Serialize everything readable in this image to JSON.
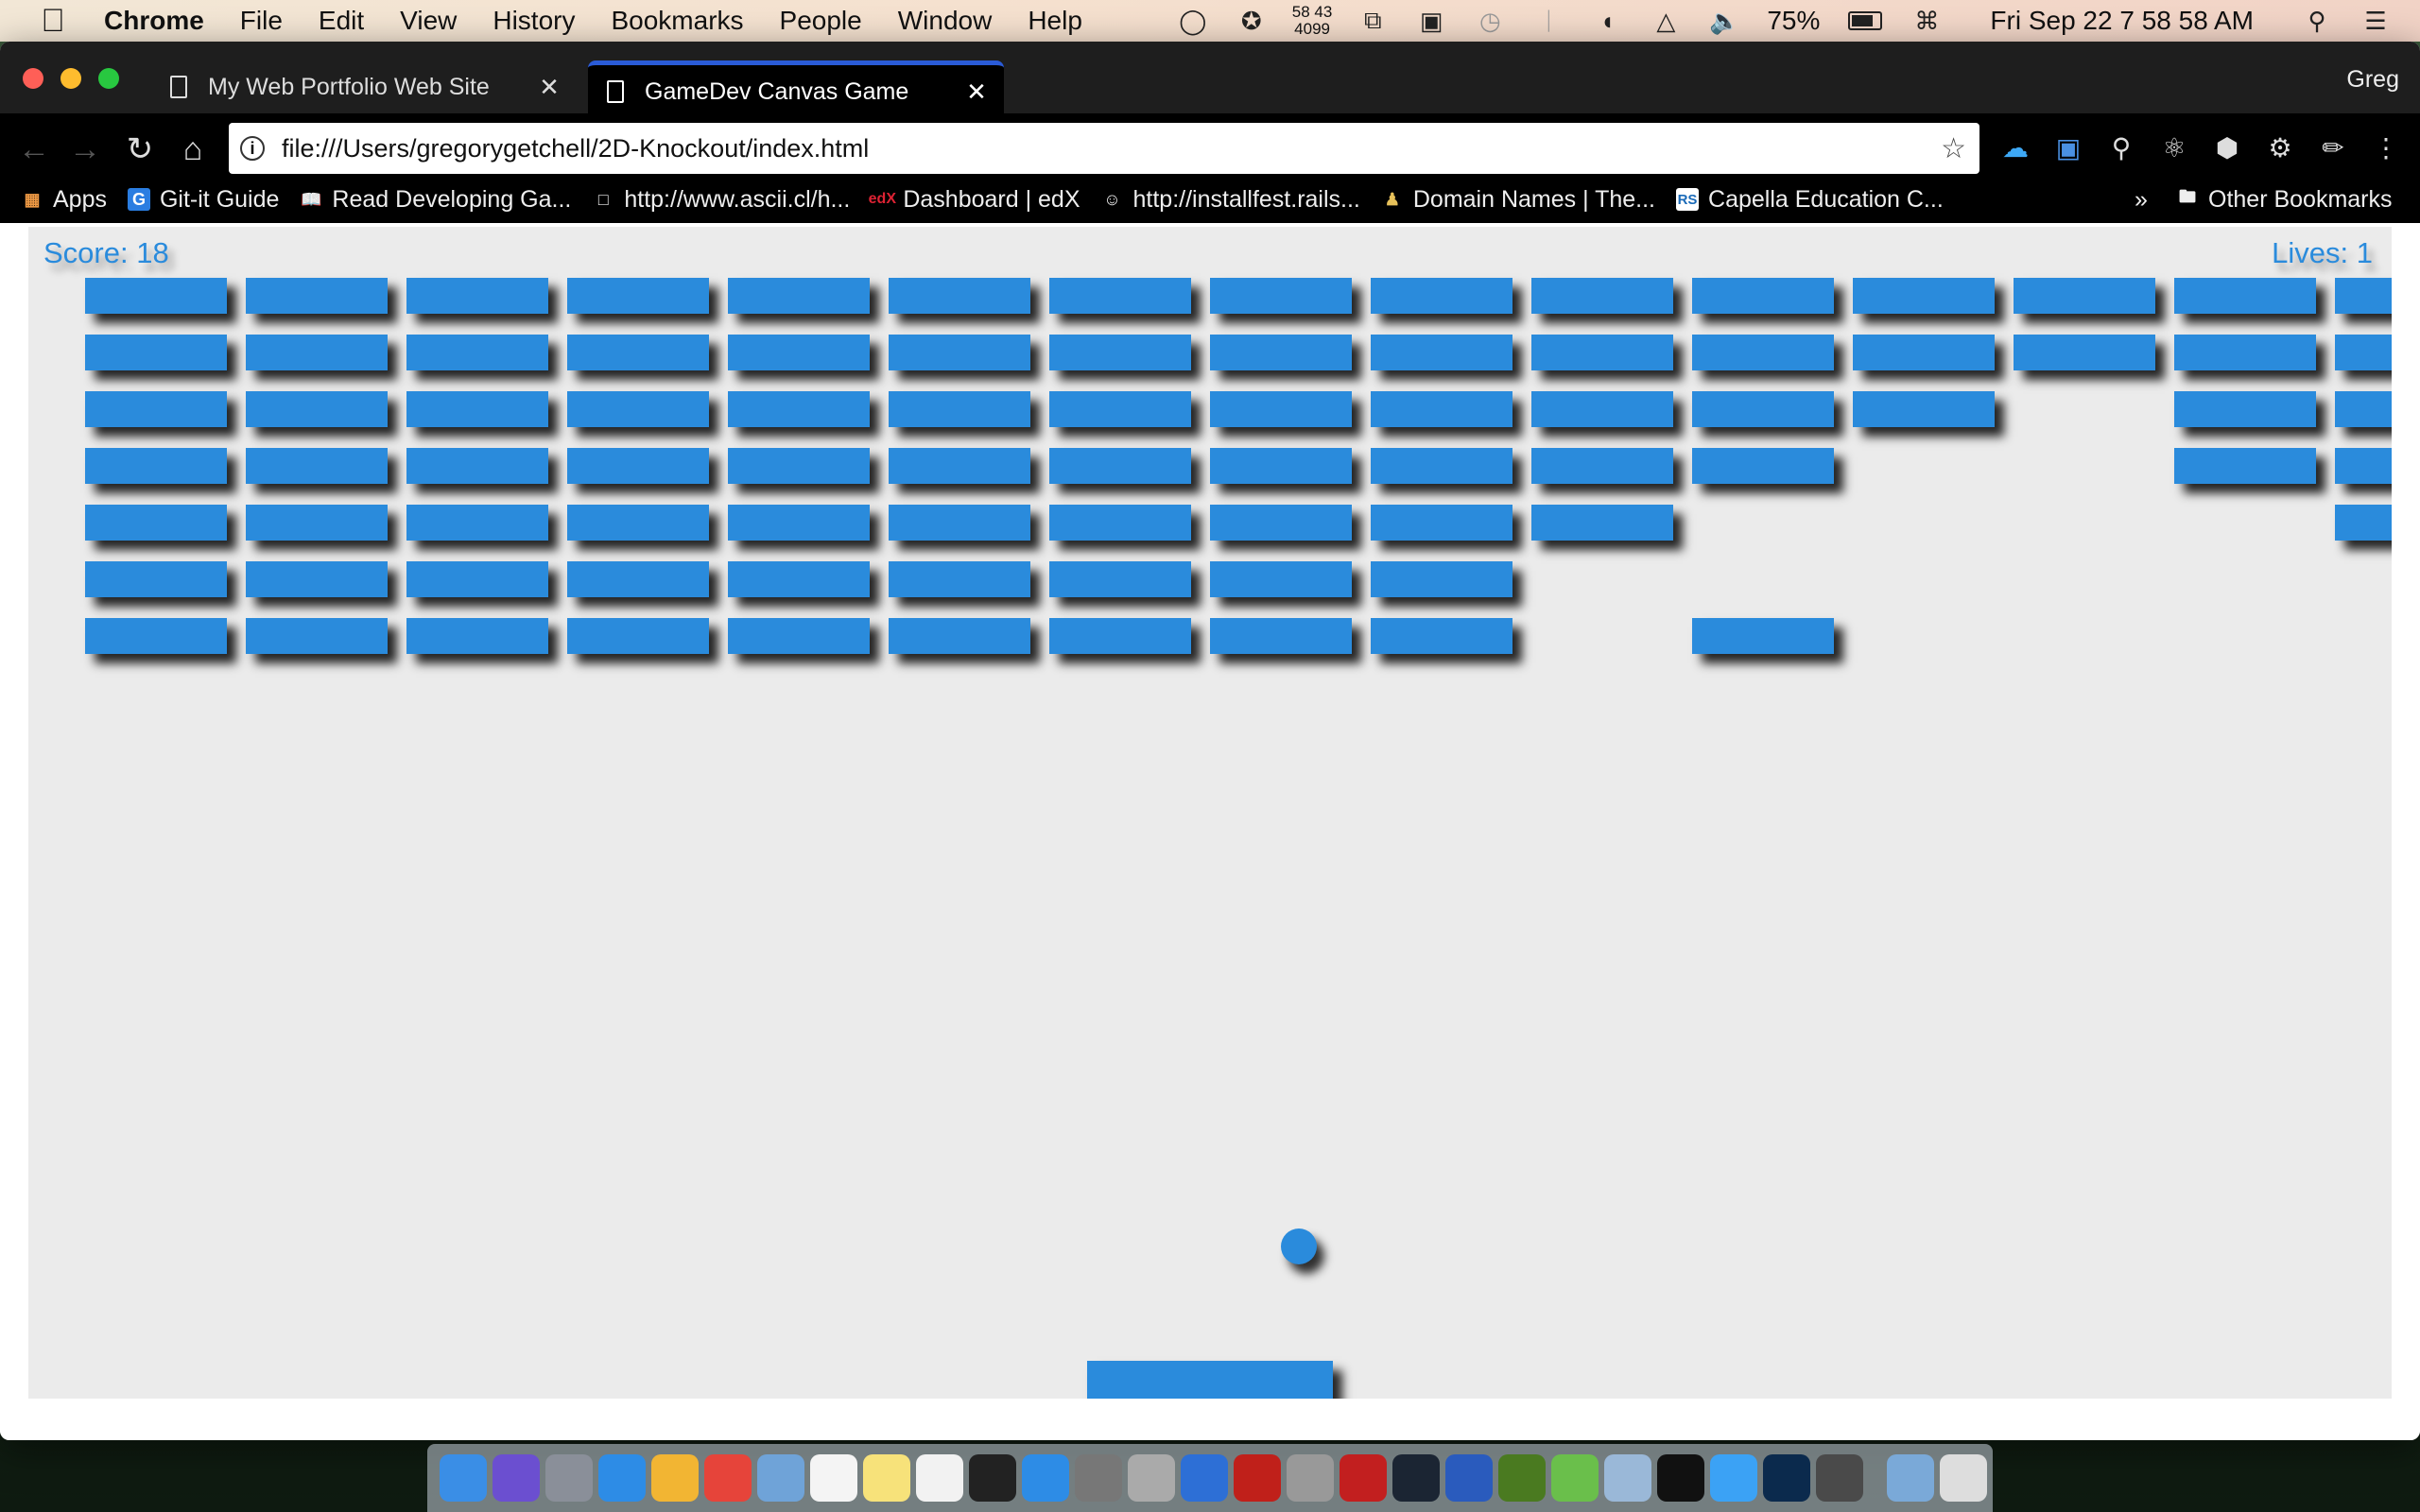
{
  "menubar": {
    "items": [
      "Chrome",
      "File",
      "Edit",
      "View",
      "History",
      "Bookmarks",
      "People",
      "Window",
      "Help"
    ],
    "status": {
      "net_top": "58 43",
      "net_bottom": "4099",
      "battery": "75%",
      "datetime": "Fri Sep 22  7 58 58 AM"
    }
  },
  "browser": {
    "tabs": [
      {
        "title": "My Web Portfolio Web Site",
        "active": false
      },
      {
        "title": "GameDev Canvas Game",
        "active": true
      }
    ],
    "profile": "Greg",
    "url": "file:///Users/gregorygetchell/2D-Knockout/index.html",
    "bookmarks": [
      {
        "label": "Apps",
        "icon": "apps-grid-icon"
      },
      {
        "label": "Git-it Guide",
        "icon": "g-icon"
      },
      {
        "label": "Read Developing Ga...",
        "icon": "book-icon"
      },
      {
        "label": "http://www.ascii.cl/h...",
        "icon": "page-icon"
      },
      {
        "label": "Dashboard | edX",
        "icon": "edx-icon"
      },
      {
        "label": "http://installfest.rails...",
        "icon": "smiley-icon"
      },
      {
        "label": "Domain Names | The...",
        "icon": "person-icon"
      },
      {
        "label": "Capella Education C...",
        "icon": "rs-icon"
      }
    ],
    "overflow": "»",
    "other_bookmarks": "Other Bookmarks"
  },
  "game": {
    "score_text": "Score: 18",
    "lives_text": "Lives: 1",
    "color": "#2a8bdc",
    "brick_grid": [
      [
        1,
        1,
        1,
        1,
        1,
        1,
        1,
        1,
        1,
        1,
        1,
        1,
        1,
        1,
        1
      ],
      [
        1,
        1,
        1,
        1,
        1,
        1,
        1,
        1,
        1,
        1,
        1,
        1,
        1,
        1,
        1
      ],
      [
        1,
        1,
        1,
        1,
        1,
        1,
        1,
        1,
        1,
        1,
        1,
        1,
        0,
        1,
        1
      ],
      [
        1,
        1,
        1,
        1,
        1,
        1,
        1,
        1,
        1,
        1,
        1,
        0,
        0,
        1,
        1
      ],
      [
        1,
        1,
        1,
        1,
        1,
        1,
        1,
        1,
        1,
        1,
        0,
        0,
        0,
        0,
        1
      ],
      [
        1,
        1,
        1,
        1,
        1,
        1,
        1,
        1,
        1,
        0,
        0,
        0,
        0,
        0,
        0
      ],
      [
        1,
        1,
        1,
        1,
        1,
        1,
        1,
        1,
        1,
        0,
        1,
        0,
        0,
        0,
        0
      ]
    ]
  },
  "dock": {
    "apps": [
      "Finder",
      "Siri",
      "Launchpad",
      "Safari",
      "Chrome Canary",
      "Chrome",
      "Preview",
      "Calendar",
      "Notes",
      "iTunes",
      "Terminal",
      "App Store",
      "System Preferences",
      "Network Utility",
      "Xcode",
      "Acrobat",
      "Keychain",
      "FileZilla",
      "Kindle",
      "Word",
      "Dw",
      "Android Studio",
      "3D Builder",
      "IntelliJ",
      "Messages",
      "Ps",
      "Sublime",
      "Downloads",
      "Trash"
    ]
  }
}
